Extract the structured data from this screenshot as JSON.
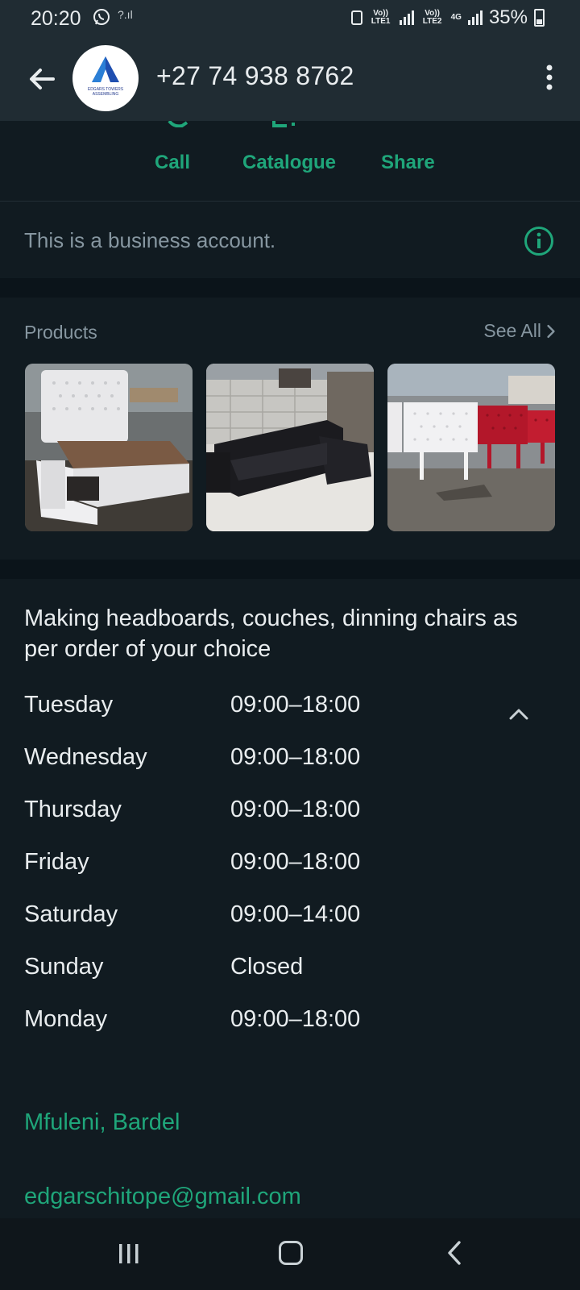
{
  "status_bar": {
    "time": "20:20",
    "sim1": "Vo)) LTE1",
    "sim2": "Vo)) LTE2",
    "net": "4G",
    "battery": "35%"
  },
  "header": {
    "title": "+27 74 938 8762",
    "avatar_text": "EDGARS TOWERS ASSEMBLING"
  },
  "actions": [
    {
      "label": "Call"
    },
    {
      "label": "Catalogue"
    },
    {
      "label": "Share"
    }
  ],
  "business_notice": "This is a business account.",
  "products": {
    "label": "Products",
    "see_all": "See All",
    "items": [
      {
        "name": "white tufted bed with storage drawers"
      },
      {
        "name": "black L-shaped couch"
      },
      {
        "name": "white and red headboards"
      }
    ]
  },
  "description": "Making headboards, couches, dinning chairs as per order of your choice",
  "hours": [
    {
      "day": "Tuesday",
      "time": "09:00–18:00"
    },
    {
      "day": "Wednesday",
      "time": "09:00–18:00"
    },
    {
      "day": "Thursday",
      "time": "09:00–18:00"
    },
    {
      "day": "Friday",
      "time": "09:00–18:00"
    },
    {
      "day": "Saturday",
      "time": "09:00–14:00"
    },
    {
      "day": "Sunday",
      "time": "Closed"
    },
    {
      "day": "Monday",
      "time": "09:00–18:00"
    }
  ],
  "location": "Mfuleni, Bardel",
  "email": "edgarschitope@gmail.com",
  "colors": {
    "background": "#111b21",
    "header": "#202c33",
    "accent": "#1fa67a",
    "muted_text": "#8696a0"
  }
}
